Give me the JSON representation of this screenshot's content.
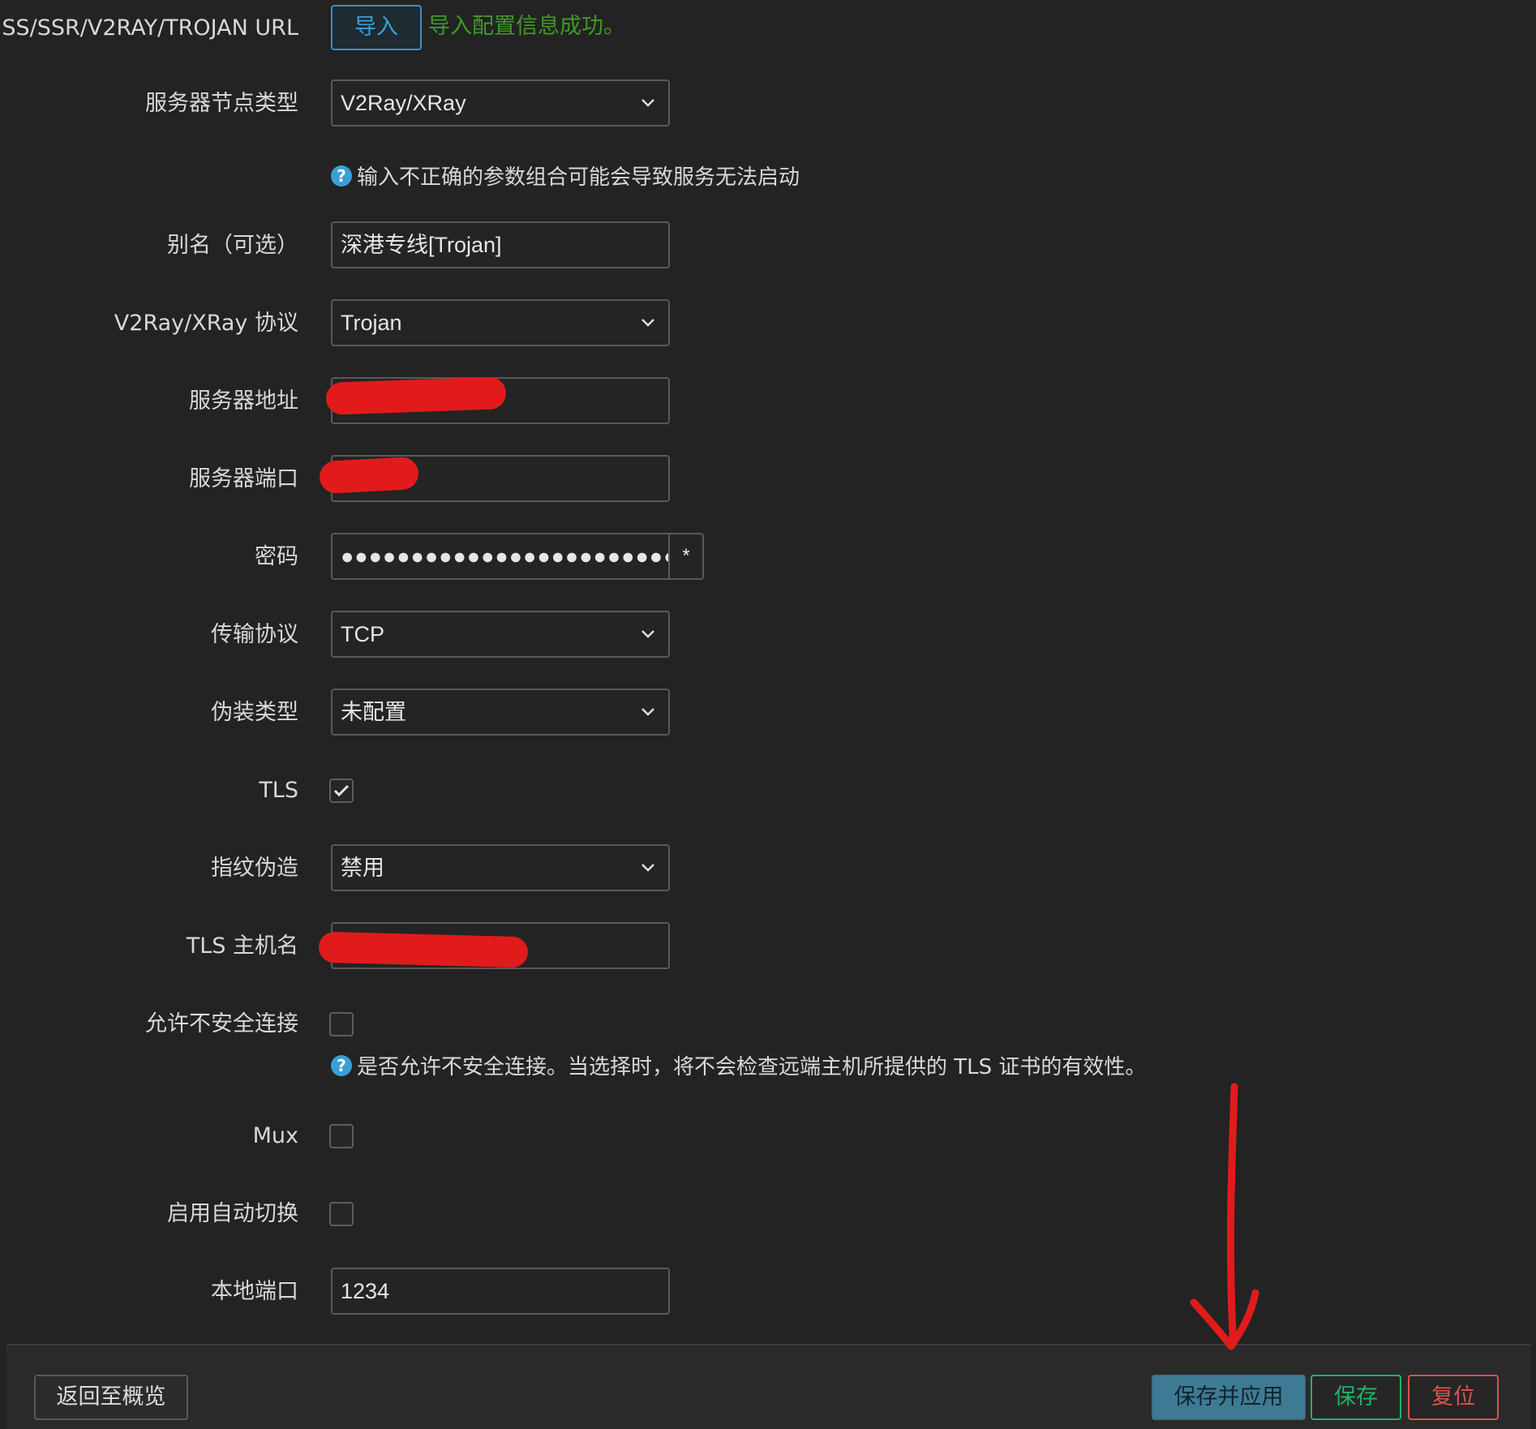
{
  "import_row": {
    "label": "SS/SSR/V2RAY/TROJAN URL",
    "button": "导入",
    "status": "导入配置信息成功。",
    "status_color": "#3f9a26"
  },
  "fields": {
    "server_node_type": {
      "label": "服务器节点类型",
      "value": "V2Ray/XRay"
    },
    "hint1": "输入不正确的参数组合可能会导致服务无法启动",
    "alias": {
      "label": "别名（可选）",
      "value": "深港专线[Trojan]"
    },
    "protocol": {
      "label": "V2Ray/XRay 协议",
      "value": "Trojan"
    },
    "server_address": {
      "label": "服务器地址",
      "value": ""
    },
    "server_port": {
      "label": "服务器端口",
      "value": ""
    },
    "password": {
      "label": "密码",
      "value": "●●●●●●●●●●●●●●●●●●●●●●●●●●",
      "reveal": "*"
    },
    "transport": {
      "label": "传输协议",
      "value": "TCP"
    },
    "disguise": {
      "label": "伪装类型",
      "value": "未配置"
    },
    "tls": {
      "label": "TLS",
      "checked": true
    },
    "fingerprint": {
      "label": "指纹伪造",
      "value": "禁用"
    },
    "tls_host": {
      "label": "TLS 主机名",
      "value": ""
    },
    "insecure": {
      "label": "允许不安全连接",
      "checked": false
    },
    "hint2": "是否允许不安全连接。当选择时，将不会检查远端主机所提供的 TLS 证书的有效性。",
    "mux": {
      "label": "Mux",
      "checked": false
    },
    "auto_switch": {
      "label": "启用自动切换",
      "checked": false
    },
    "local_port": {
      "label": "本地端口",
      "value": "1234"
    }
  },
  "footer": {
    "back": "返回至概览",
    "save_apply": "保存并应用",
    "save": "保存",
    "reset": "复位"
  },
  "colors": {
    "background": "#232323",
    "accent_blue": "#3a9fd6",
    "save_apply_bg": "#3f7a94",
    "save_green": "#20b26a",
    "reset_red": "#d9534f",
    "redaction": "#e11b1b"
  },
  "icons": [
    "chevron-down-icon",
    "help-icon",
    "check-icon",
    "arrow-down-annotation"
  ]
}
